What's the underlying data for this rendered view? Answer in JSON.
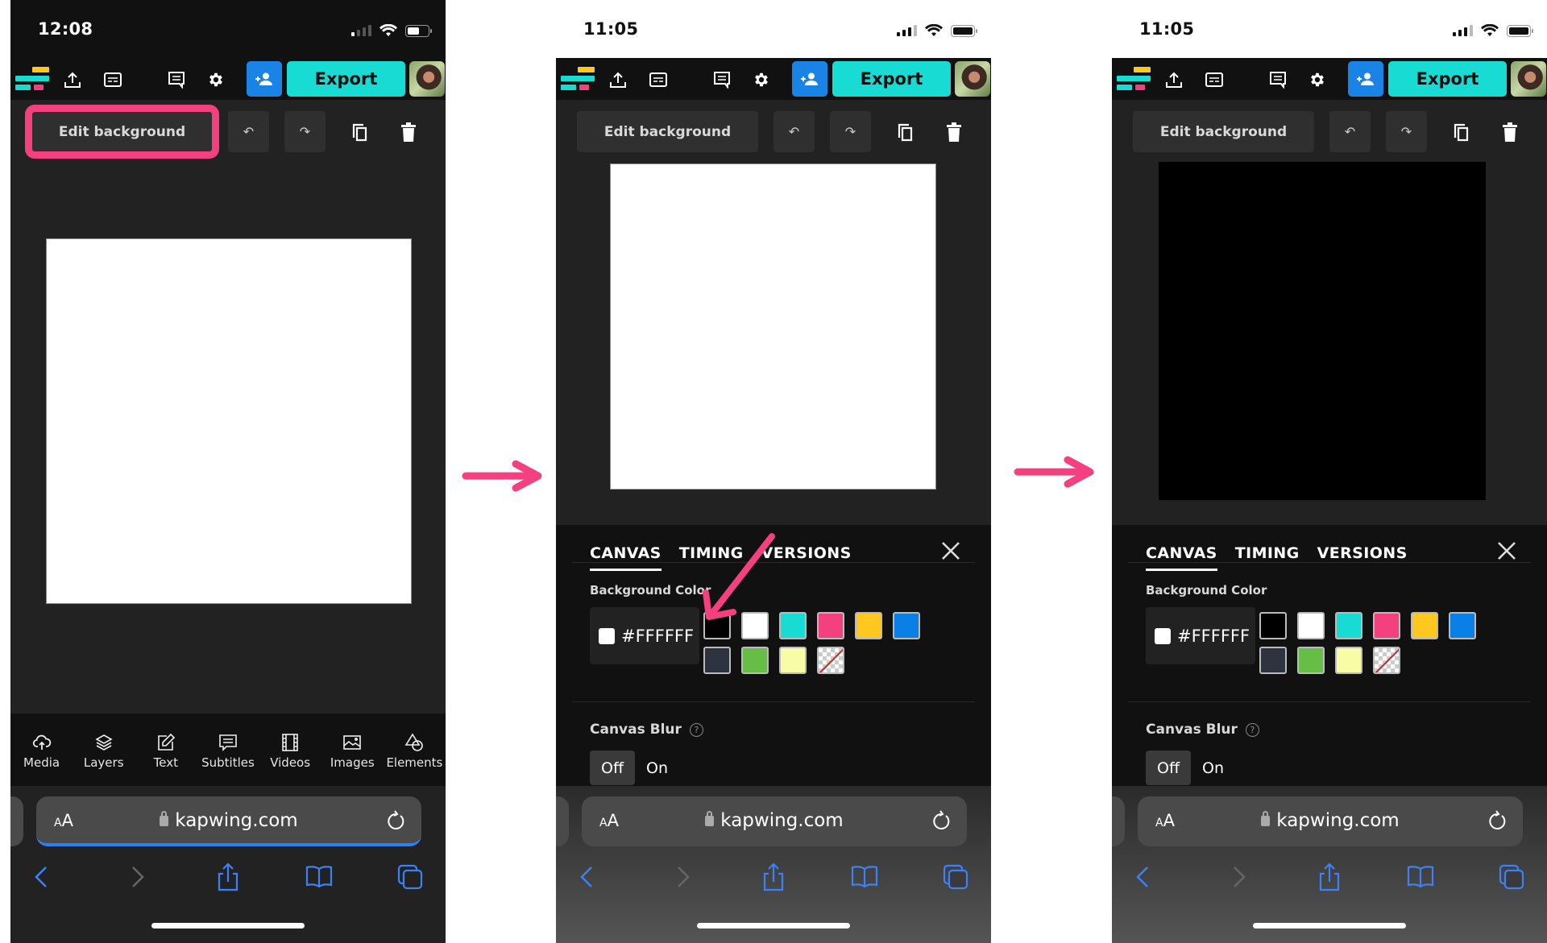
{
  "phones": [
    {
      "status": {
        "time": "12:08",
        "theme": "dark",
        "battery_level": 0.6
      },
      "header": {
        "export_label": "Export"
      },
      "edit_toolbar": {
        "edit_background_label": "Edit background",
        "highlighted": true
      },
      "canvas": {
        "background_color": "#FFFFFF"
      },
      "bottom_tools": [
        "Media",
        "Layers",
        "Text",
        "Subtitles",
        "Videos",
        "Images",
        "Elements"
      ],
      "safari": {
        "text_size_label": "AA",
        "url": "kapwing.com",
        "loading": true
      }
    },
    {
      "status": {
        "time": "11:05",
        "theme": "light",
        "battery_level": 1.0
      },
      "header": {
        "export_label": "Export"
      },
      "edit_toolbar": {
        "edit_background_label": "Edit background",
        "highlighted": false
      },
      "canvas": {
        "background_color": "#FFFFFF"
      },
      "panel": {
        "tabs": [
          "CANVAS",
          "TIMING",
          "VERSIONS"
        ],
        "active_tab": "CANVAS",
        "background_color_label": "Background Color",
        "hex_value": "#FFFFFF",
        "swatches": [
          "#000000",
          "#FFFFFF",
          "#18DCD3",
          "#F5407F",
          "#FFC81F",
          "#0A7FE6",
          "#2E3340",
          "#66BE46",
          "#F8FCA4",
          "transparent"
        ],
        "canvas_blur_label": "Canvas Blur",
        "blur_options": [
          "Off",
          "On"
        ],
        "blur_selected": "Off",
        "annotation": "arrow pointing to black swatch"
      },
      "safari": {
        "text_size_label": "AA",
        "url": "kapwing.com",
        "loading": false
      }
    },
    {
      "status": {
        "time": "11:05",
        "theme": "light",
        "battery_level": 1.0
      },
      "header": {
        "export_label": "Export"
      },
      "edit_toolbar": {
        "edit_background_label": "Edit background",
        "highlighted": false
      },
      "canvas": {
        "background_color": "#000000"
      },
      "panel": {
        "tabs": [
          "CANVAS",
          "TIMING",
          "VERSIONS"
        ],
        "active_tab": "CANVAS",
        "background_color_label": "Background Color",
        "hex_value": "#FFFFFF",
        "swatches": [
          "#000000",
          "#FFFFFF",
          "#18DCD3",
          "#F5407F",
          "#FFC81F",
          "#0A7FE6",
          "#2E3340",
          "#66BE46",
          "#F8FCA4",
          "transparent"
        ],
        "canvas_blur_label": "Canvas Blur",
        "blur_options": [
          "Off",
          "On"
        ],
        "blur_selected": "Off"
      },
      "safari": {
        "text_size_label": "AA",
        "url": "kapwing.com",
        "loading": false
      }
    }
  ],
  "colors": {
    "accent_pink": "#F5407F",
    "export_teal": "#18DCD3",
    "invite_blue": "#1A84E6",
    "safari_blue": "#2F80ED",
    "logo_yellow": "#FFC81F",
    "logo_teal": "#18DCD3",
    "logo_pink": "#F5407F"
  }
}
